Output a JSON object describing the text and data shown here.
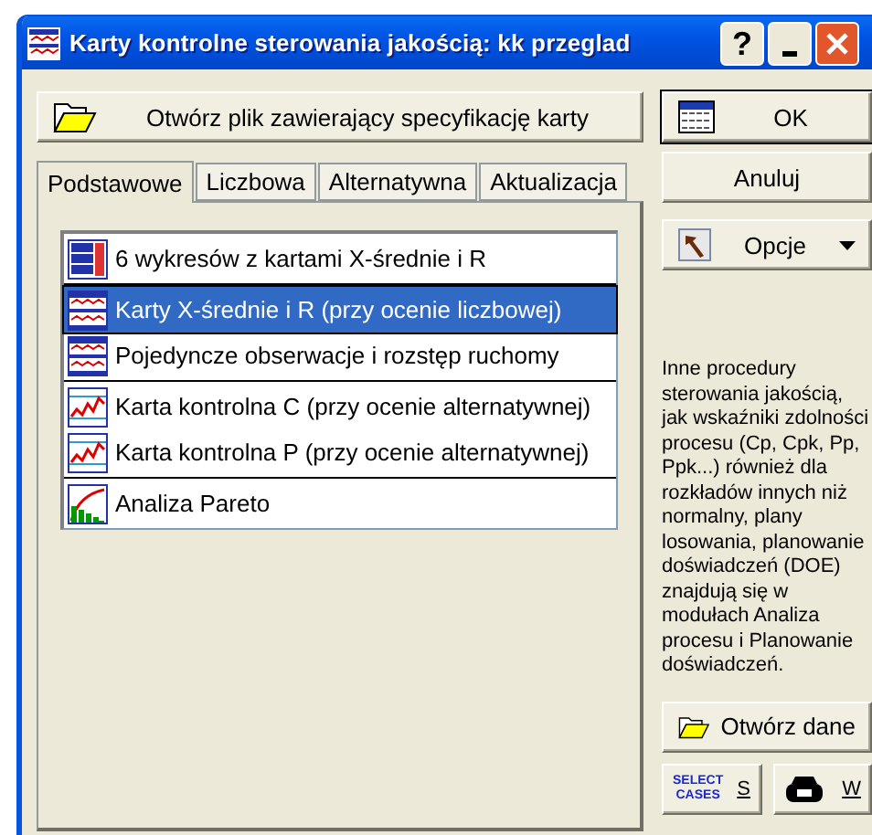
{
  "window": {
    "title": "Karty kontrolne sterowania jakością: kk przeglad",
    "help_button": "?"
  },
  "open_spec_button": "Otwórz plik zawierający specyfikację karty",
  "tabs": [
    {
      "label": "Podstawowe",
      "selected": true
    },
    {
      "label": "Liczbowa",
      "selected": false
    },
    {
      "label": "Alternatywna",
      "selected": false
    },
    {
      "label": "Aktualizacja",
      "selected": false
    }
  ],
  "list_groups": [
    [
      {
        "label": "6 wykresów z kartami X-średnie i R",
        "kind": "multi",
        "selected": false
      }
    ],
    [
      {
        "label": "Karty X-średnie i R (przy ocenie liczbowej)",
        "kind": "dual",
        "selected": true
      },
      {
        "label": "Pojedyncze obserwacje i rozstęp ruchomy",
        "kind": "dual",
        "selected": false
      }
    ],
    [
      {
        "label": "Karta kontrolna C (przy ocenie alternatywnej)",
        "kind": "single",
        "selected": false
      },
      {
        "label": "Karta kontrolna P (przy ocenie alternatywnej)",
        "kind": "single",
        "selected": false
      }
    ],
    [
      {
        "label": "Analiza Pareto",
        "kind": "pareto",
        "selected": false
      }
    ]
  ],
  "ok_button": "OK",
  "cancel_button": "Anuluj",
  "options_button": "Opcje",
  "info_text": "Inne procedury sterowania jakością, jak wskaźniki zdolności procesu (Cp, Cpk, Pp, Ppk...) również dla rozkładów innych niż normalny, plany losowania, planowanie doświadczeń (DOE) znajdują się w modułach Analiza procesu i Planowanie doświadczeń.",
  "open_data_button": "Otwórz dane",
  "select_cases": {
    "icon_text": [
      "SELECT",
      "CASES"
    ],
    "key": "S"
  },
  "weight_button": {
    "key": "W"
  }
}
